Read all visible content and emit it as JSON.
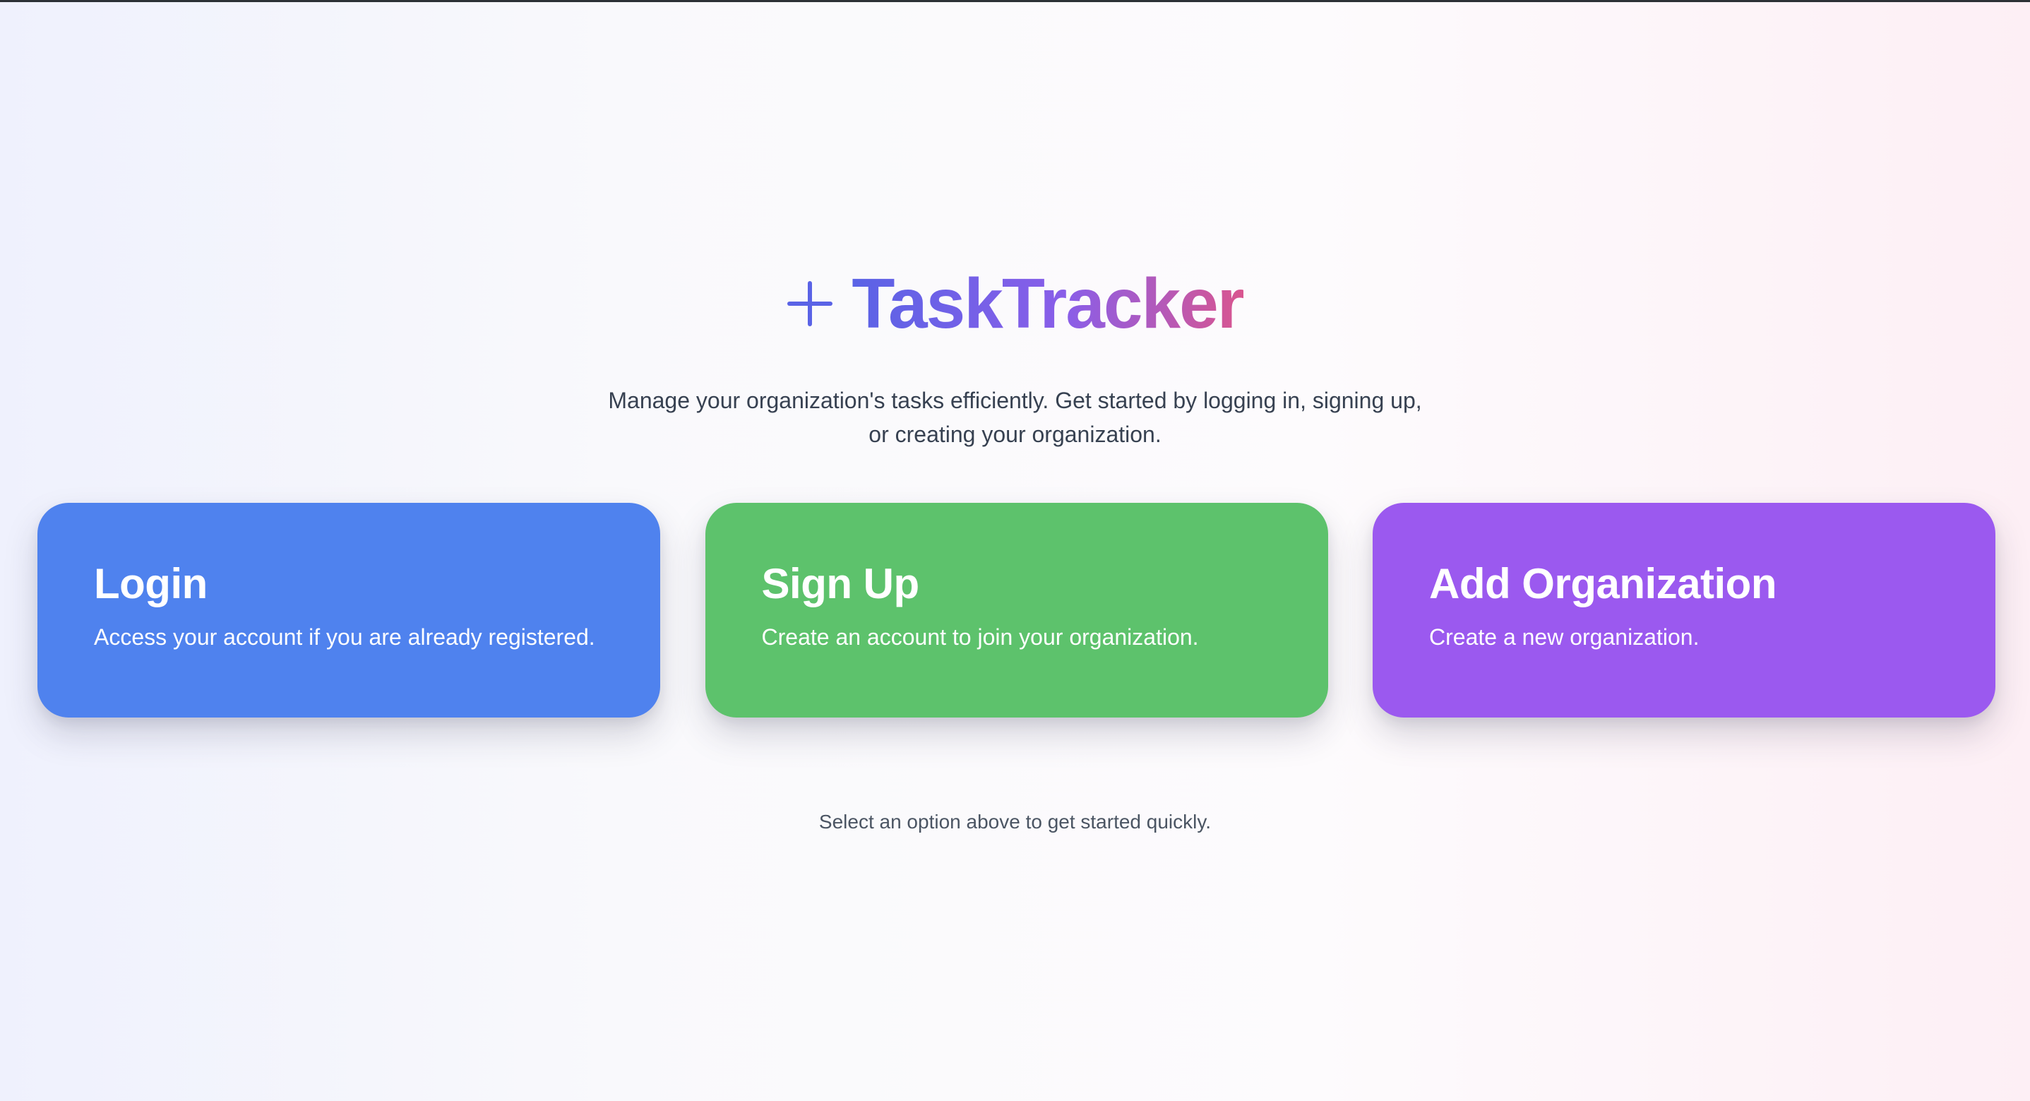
{
  "brand": {
    "icon": "plus-icon",
    "title": "TaskTracker",
    "gradient_colors": [
      "#5a63e6",
      "#8a5ee8",
      "#d9558f"
    ]
  },
  "hero": {
    "subtitle": "Manage your organization's tasks efficiently. Get started by logging in, signing up, or creating your organization."
  },
  "cards": [
    {
      "title": "Login",
      "description": "Access your account if you are already registered.",
      "color": "#4f82ee"
    },
    {
      "title": "Sign Up",
      "description": "Create an account to join your organization.",
      "color": "#5dc26c"
    },
    {
      "title": "Add Organization",
      "description": "Create a new organization.",
      "color": "#9b59ef"
    }
  ],
  "footer": {
    "note": "Select an option above to get started quickly."
  }
}
